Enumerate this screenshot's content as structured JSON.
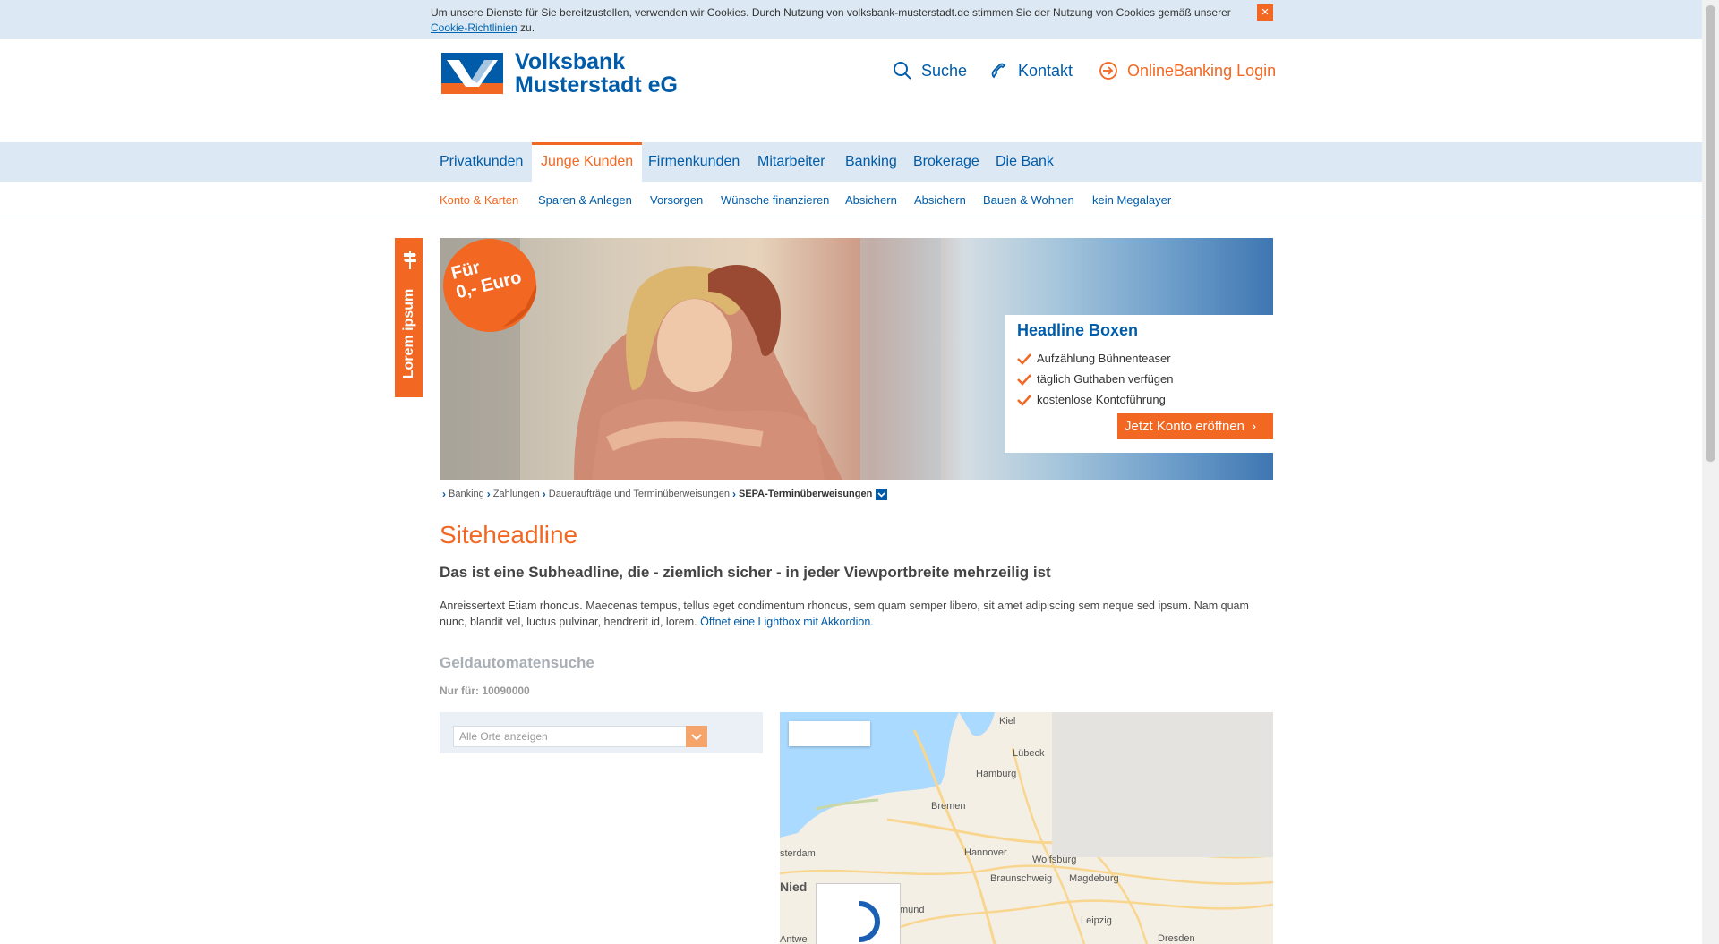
{
  "cookie_bar": {
    "text_before": "Um unsere Dienste für Sie bereitzustellen, verwenden wir Cookies. Durch Nutzung von volksbank-musterstadt.de stimmen Sie der Nutzung von Cookies gemäß unserer ",
    "link": "Cookie-Richtlinien",
    "text_after": " zu.",
    "close_icon": "×"
  },
  "logo": {
    "line1": "Volksbank",
    "line2": "Musterstadt eG"
  },
  "top_links": [
    {
      "label": "Suche",
      "icon": "search-icon"
    },
    {
      "label": "Kontakt",
      "icon": "phone-icon"
    },
    {
      "label": "OnlineBanking Login",
      "icon": "login-icon"
    }
  ],
  "main_nav": [
    "Privatkunden",
    "Junge Kunden",
    "Firmenkunden",
    "Mitarbeiter",
    "Banking",
    "Brokerage",
    "Die Bank"
  ],
  "sub_nav": [
    "Konto & Karten",
    "Sparen & Anlegen",
    "Vorsorgen",
    "Wünsche finanzieren",
    "Absichern",
    "Absichern",
    "Bauen & Wohnen",
    "kein Megalayer"
  ],
  "side_tab": {
    "label": "Lorem ipsum"
  },
  "hero": {
    "badge_line1": "Für",
    "badge_line2": "0,- Euro",
    "box_title": "Headline Boxen",
    "bullets": [
      "Aufzählung Bühnenteaser",
      "täglich Guthaben verfügen",
      "kostenlose Kontoführung"
    ],
    "cta": "Jetzt Konto eröffnen"
  },
  "breadcrumb": {
    "items": [
      "Banking",
      "Zahlungen",
      "Daueraufträge und Terminüberweisungen"
    ],
    "current": "SEPA-Terminüberweisungen"
  },
  "content": {
    "headline": "Siteheadline",
    "subheadline": "Das ist eine Subheadline, die - ziemlich sicher - in jeder Viewportbreite mehrzeilig ist",
    "intro": "Anreissertext Etiam rhoncus. Maecenas tempus, tellus eget condimentum rhoncus, sem quam semper libero, sit amet adipiscing sem neque sed ipsum. Nam quam nunc, blandit vel, luctus pulvinar, hendrerit id, lorem. ",
    "intro_link": "Öffnet eine Lightbox mit Akkordion."
  },
  "atm": {
    "title": "Geldautomatensuche",
    "note": "Nur für: 10090000",
    "select_placeholder": "Alle Orte anzeigen"
  },
  "map": {
    "labels": [
      "Kiel",
      "Lübeck",
      "Hamburg",
      "Bremen",
      "Hannover",
      "Wolfsburg",
      "Braunschweig",
      "Magdeburg",
      "sterdam",
      "Nied",
      "mund",
      "Leipzig",
      "Dresden",
      "Antwe"
    ]
  },
  "colors": {
    "brand_blue": "#005ca9",
    "brand_orange": "#f26722",
    "nav_bg": "#dce8f3"
  }
}
